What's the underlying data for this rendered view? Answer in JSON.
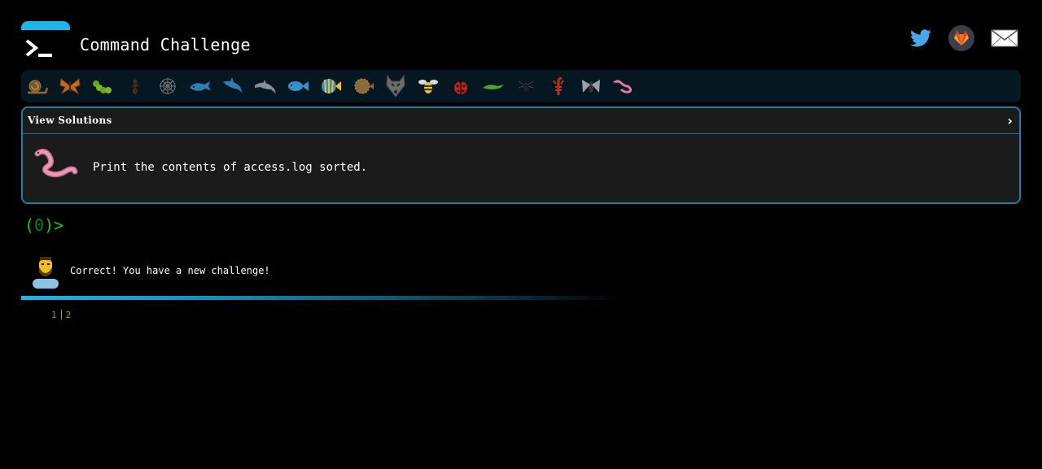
{
  "header": {
    "title": "Command Challenge",
    "social": [
      "twitter-icon",
      "gitlab-icon",
      "mail-icon"
    ]
  },
  "critters": [
    "snail",
    "butterfly",
    "caterpillar",
    "ant",
    "spider-web",
    "whale",
    "shark",
    "dolphin",
    "fish",
    "tropical-fish",
    "blowfish",
    "wolf",
    "bee",
    "ladybug",
    "lizard",
    "spider",
    "scorpion",
    "fly",
    "worm"
  ],
  "panel": {
    "toggle_label": "View Solutions",
    "challenge_text": "Print the contents of access.log sorted."
  },
  "prompt": {
    "open": "(",
    "count": "0",
    "close": ")",
    "arrow": ">"
  },
  "feedback": {
    "message": "Correct! You have a new challenge!"
  },
  "line_numbers": [
    "1",
    "2"
  ],
  "colors": {
    "accent": "#1ab7ea",
    "prompt_green": "#17c917",
    "panel_bg": "#1b1b1b",
    "panel_border": "#1f7ea6"
  }
}
